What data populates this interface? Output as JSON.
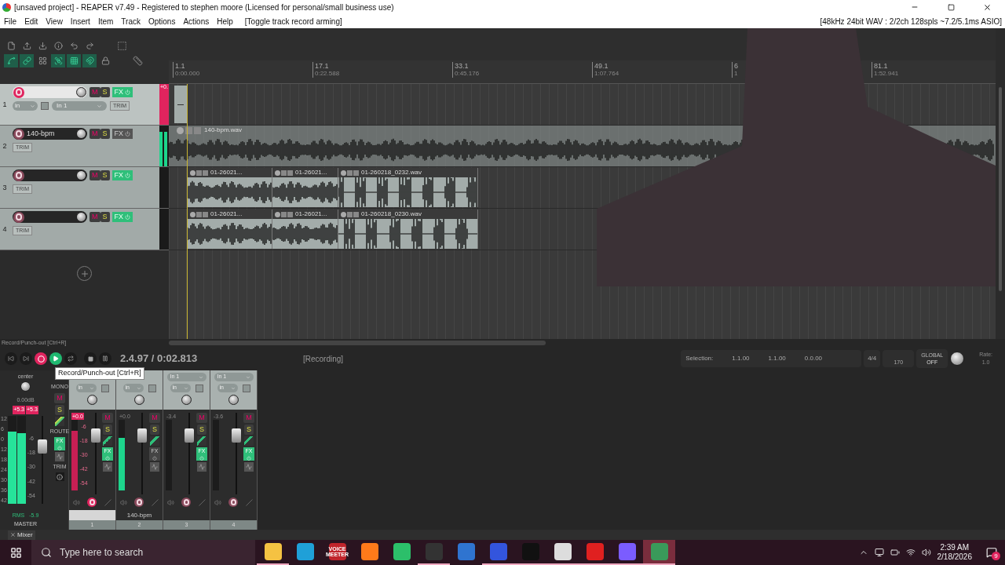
{
  "window": {
    "title": "[unsaved project] - REAPER v7.49 - Registered to stephen moore (Licensed for personal/small business use)"
  },
  "menu": {
    "items": [
      "File",
      "Edit",
      "View",
      "Insert",
      "Item",
      "Track",
      "Options",
      "Actions",
      "Help"
    ],
    "action_hint": "[Toggle track record arming]",
    "audio_status": "[48kHz 24bit WAV : 2/2ch 128spls ~7.2/5.1ms ASIO]"
  },
  "toolbar": {
    "toggles": [
      {
        "on": true
      },
      {
        "on": true
      },
      {
        "on": false
      },
      {
        "on": true
      },
      {
        "on": true
      },
      {
        "on": true
      },
      {
        "on": false
      }
    ]
  },
  "ruler": {
    "markers": [
      {
        "bar": "1.1",
        "time": "0:00.000"
      },
      {
        "bar": "17.1",
        "time": "0:22.588"
      },
      {
        "bar": "33.1",
        "time": "0:45.176"
      },
      {
        "bar": "49.1",
        "time": "1:07.764"
      },
      {
        "bar": "6",
        "time": "1"
      },
      {
        "bar": "81.1",
        "time": "1:52.941"
      }
    ]
  },
  "tracks": [
    {
      "number": "1",
      "armed": true,
      "selected": true,
      "fx_active": true,
      "level": 1,
      "clip_label": "+0.",
      "input_mode": "in",
      "input": "In 1",
      "mute_label": "M",
      "solo_label": "S",
      "fx_label": "FX",
      "trim_label": "TRIM",
      "items": [
        {
          "kind": "recording"
        }
      ]
    },
    {
      "number": "2",
      "name": "140-bpm",
      "armed": false,
      "selected": false,
      "fx_active": false,
      "level": 0.85,
      "mute_label": "M",
      "solo_label": "S",
      "fx_label": "FX",
      "trim_label": "TRIM",
      "items": [
        {
          "kind": "loop",
          "label": "140-bpm.wav"
        }
      ]
    },
    {
      "number": "3",
      "armed": false,
      "selected": false,
      "fx_active": true,
      "mute_label": "M",
      "solo_label": "S",
      "fx_label": "FX",
      "trim_label": "TRIM",
      "items": [
        {
          "kind": "take",
          "label": "01-26021..."
        },
        {
          "kind": "take",
          "label": "01-26021..."
        },
        {
          "kind": "take",
          "label": "01-260218_0232.wav"
        }
      ]
    },
    {
      "number": "4",
      "armed": false,
      "selected": false,
      "fx_active": true,
      "mute_label": "M",
      "solo_label": "S",
      "fx_label": "FX",
      "trim_label": "TRIM",
      "items": [
        {
          "kind": "take",
          "label": "01-26021..."
        },
        {
          "kind": "take",
          "label": "01-26021..."
        },
        {
          "kind": "take",
          "label": "01-260218_0230.wav"
        }
      ]
    }
  ],
  "transport": {
    "hint": "Record/Punch-out [Ctrl+R]",
    "buttons": [
      {
        "kind": "start",
        "on": false
      },
      {
        "kind": "end",
        "on": false
      },
      {
        "kind": "record",
        "on": true
      },
      {
        "kind": "play",
        "on": true
      },
      {
        "kind": "repeat",
        "on": false
      },
      {
        "kind": "stop",
        "on": false
      },
      {
        "kind": "pause",
        "on": false
      }
    ],
    "position": "2.4.97 / 0:02.813",
    "status": "[Recording]",
    "selection_label": "Selection:",
    "selection_start": "1.1.00",
    "selection_end": "1.1.00",
    "selection_length": "0.0.00",
    "time_signature": "4/4",
    "tempo": "170",
    "global_label": "GLOBAL",
    "global_value": "OFF",
    "rate_label": "Rate:",
    "rate": "1.0",
    "tooltip": "Record/Punch-out [Ctrl+R]"
  },
  "master": {
    "pan": "center",
    "volume": "0.00dB",
    "peaks": [
      "+5.3",
      "+5.3"
    ],
    "scale": [
      "12",
      "6",
      "0",
      "12",
      "18",
      "24",
      "30",
      "36",
      "42"
    ],
    "inner_scale": [
      "-6",
      "-18",
      "-30",
      "-42",
      "-54"
    ],
    "meters": [
      {
        "level": 0.82
      },
      {
        "level": 0.8
      }
    ],
    "rms_label": "RMS",
    "rms": "-5.9",
    "name": "MASTER",
    "mono_label": "MONO",
    "mute_label": "M",
    "solo_label": "S",
    "route_label": "ROUTE",
    "fx_label": "FX",
    "trim_label": "TRIM"
  },
  "mixer": {
    "channels": [
      {
        "number": "1",
        "input_mode": "in",
        "volume": "+0.0",
        "clipping": true,
        "armed": true,
        "selected": true,
        "fx_active": true,
        "level": 0.85,
        "scale": [
          "-6",
          "-18",
          "-30",
          "-42",
          "-54"
        ],
        "mute_label": "M",
        "solo_label": "S",
        "fx_label": "FX"
      },
      {
        "number": "2",
        "name": "140-bpm",
        "input_mode": "in",
        "volume": "+0.0",
        "clipping": false,
        "armed": false,
        "selected": false,
        "fx_active": false,
        "level": 0.75,
        "mute_label": "M",
        "solo_label": "S",
        "fx_label": "FX"
      },
      {
        "number": "3",
        "input": "In 1",
        "input_mode": "in",
        "volume": "-3.4",
        "clipping": false,
        "armed": false,
        "selected": false,
        "fx_active": true,
        "mute_label": "M",
        "solo_label": "S",
        "fx_label": "FX"
      },
      {
        "number": "4",
        "input": "In 1",
        "input_mode": "in",
        "volume": "-3.6",
        "clipping": false,
        "armed": false,
        "selected": false,
        "fx_active": true,
        "mute_label": "M",
        "solo_label": "S",
        "fx_label": "FX"
      }
    ],
    "tab": "Mixer"
  },
  "taskbar": {
    "search_placeholder": "Type here to search",
    "apps": [
      {
        "kind": "folder",
        "running": true,
        "active": false
      },
      {
        "kind": "edge",
        "running": false,
        "active": false
      },
      {
        "kind": "voicemeeter",
        "label": "VOICE MEETER",
        "running": false,
        "active": false
      },
      {
        "kind": "firefox",
        "running": false,
        "active": false
      },
      {
        "kind": "android",
        "running": false,
        "active": false
      },
      {
        "kind": "obs",
        "running": true,
        "active": false
      },
      {
        "kind": "sync",
        "running": false,
        "active": false
      },
      {
        "kind": "media",
        "running": true,
        "active": false
      },
      {
        "kind": "terminal",
        "running": true,
        "active": false
      },
      {
        "kind": "window",
        "running": true,
        "active": false
      },
      {
        "kind": "youtube",
        "running": true,
        "active": false
      },
      {
        "kind": "streamlabs",
        "running": true,
        "active": false
      },
      {
        "kind": "reaper",
        "running": true,
        "active": true
      }
    ],
    "time": "2:39 AM",
    "date": "2/18/2026",
    "notification_count": "9"
  }
}
